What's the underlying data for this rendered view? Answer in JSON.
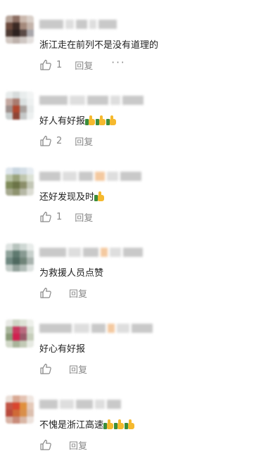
{
  "comments": [
    {
      "text": "浙江走在前列不是没有道理的",
      "thumbs": 0,
      "likes": "1",
      "reply": "回复",
      "has_more": true
    },
    {
      "text": "好人有好报",
      "thumbs": 3,
      "likes": "2",
      "reply": "回复",
      "has_more": false
    },
    {
      "text": "还好发现及时",
      "thumbs": 1,
      "likes": "1",
      "reply": "回复",
      "has_more": false
    },
    {
      "text": "为救援人员点赞",
      "thumbs": 0,
      "likes": "",
      "reply": "回复",
      "has_more": false
    },
    {
      "text": "好心有好报",
      "thumbs": 0,
      "likes": "",
      "reply": "回复",
      "has_more": false
    },
    {
      "text": "不愧是浙江高速",
      "thumbs": 3,
      "likes": "",
      "reply": "回复",
      "has_more": false
    }
  ],
  "more_glyph": "···",
  "icons": {
    "like": "thumbs-up-outline-icon",
    "emoji": "thumbs-up-emoji-icon"
  },
  "colors": {
    "text": "#222222",
    "meta": "#888888",
    "blurred_name": "#c9c9c9"
  }
}
